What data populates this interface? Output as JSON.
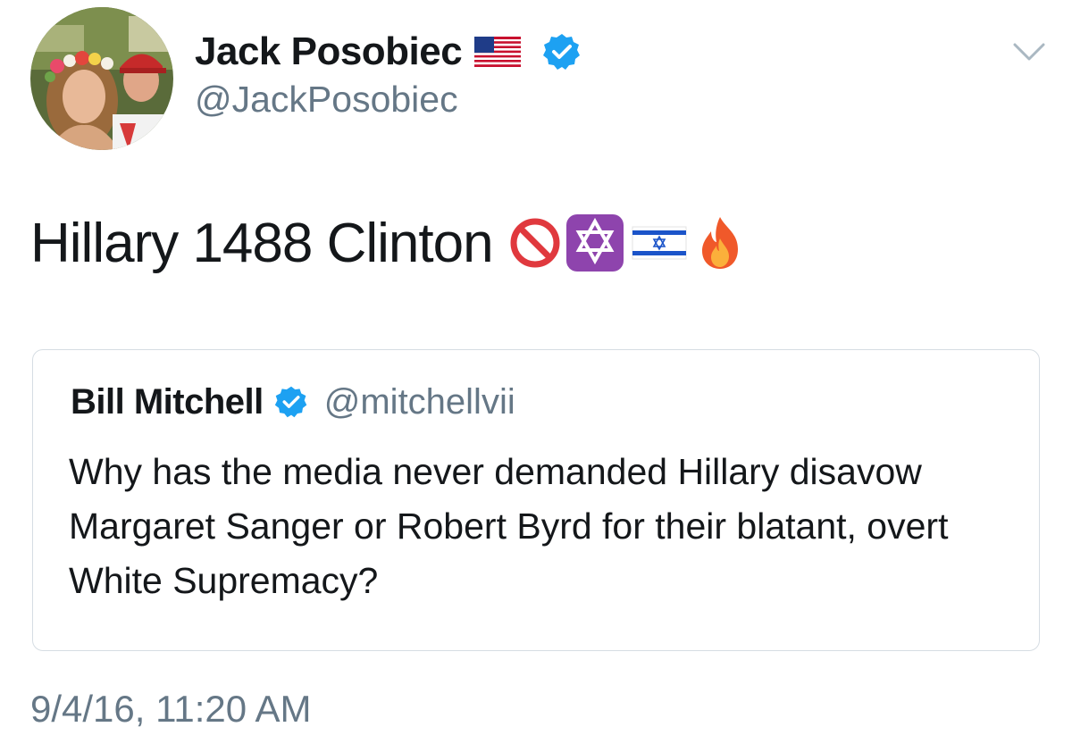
{
  "tweet": {
    "author": {
      "display_name": "Jack Posobiec",
      "handle": "@JackPosobiec",
      "verified": true,
      "name_flag_icon": "us-flag-icon",
      "avatar_icon": "profile-photo-avatar"
    },
    "menu_icon": "chevron-down-icon",
    "text": "Hillary 1488 Clinton",
    "emojis": [
      "no-entry-sign-icon",
      "star-of-david-icon",
      "israel-flag-icon",
      "fire-icon"
    ],
    "quoted_tweet": {
      "display_name": "Bill Mitchell",
      "handle": "@mitchellvii",
      "verified": true,
      "text": "Why has the media never demanded Hillary disavow Margaret Sanger or Robert Byrd for their blatant, overt White Supremacy?"
    },
    "timestamp": "9/4/16, 11:20 AM"
  },
  "colors": {
    "text_primary": "#14171a",
    "text_secondary": "#657786",
    "verified_blue": "#1da1f2",
    "card_border": "#d6dde3"
  }
}
